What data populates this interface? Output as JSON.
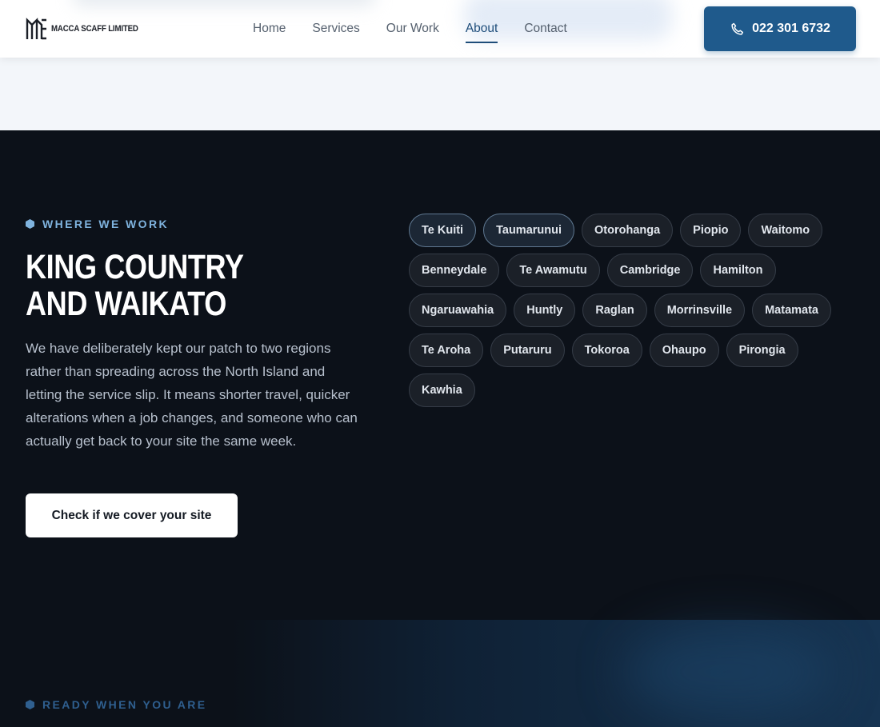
{
  "brand": {
    "name": "MACCA SCAFF LIMITED"
  },
  "nav": {
    "items": [
      {
        "label": "Home",
        "active": false
      },
      {
        "label": "Services",
        "active": false
      },
      {
        "label": "Our Work",
        "active": false
      },
      {
        "label": "About",
        "active": true
      },
      {
        "label": "Contact",
        "active": false
      }
    ],
    "phone_label": "022 301 6732",
    "phone_icon": "phone-icon"
  },
  "coverage": {
    "eyebrow": "WHERE WE WORK",
    "heading_line1": "KING COUNTRY",
    "heading_line2": "AND WAIKATO",
    "body": "We have deliberately kept our patch to two regions rather than spreading across the North Island and letting the service slip. It means shorter travel, quicker alterations when a job changes, and someone who can actually get back to your site the same week.",
    "cta_label": "Check if we cover your site",
    "towns": [
      {
        "label": "Te Kuiti",
        "highlighted": true
      },
      {
        "label": "Taumarunui",
        "highlighted": true
      },
      {
        "label": "Otorohanga",
        "highlighted": false
      },
      {
        "label": "Piopio",
        "highlighted": false
      },
      {
        "label": "Waitomo",
        "highlighted": false
      },
      {
        "label": "Benneydale",
        "highlighted": false
      },
      {
        "label": "Te Awamutu",
        "highlighted": false
      },
      {
        "label": "Cambridge",
        "highlighted": false
      },
      {
        "label": "Hamilton",
        "highlighted": false
      },
      {
        "label": "Ngaruawahia",
        "highlighted": false
      },
      {
        "label": "Huntly",
        "highlighted": false
      },
      {
        "label": "Raglan",
        "highlighted": false
      },
      {
        "label": "Morrinsville",
        "highlighted": false
      },
      {
        "label": "Matamata",
        "highlighted": false
      },
      {
        "label": "Te Aroha",
        "highlighted": false
      },
      {
        "label": "Putaruru",
        "highlighted": false
      },
      {
        "label": "Tokoroa",
        "highlighted": false
      },
      {
        "label": "Ohaupo",
        "highlighted": false
      },
      {
        "label": "Pirongia",
        "highlighted": false
      },
      {
        "label": "Kawhia",
        "highlighted": false
      }
    ]
  },
  "next_section": {
    "eyebrow": "READY WHEN YOU ARE"
  },
  "colors": {
    "primary": "#1f5a8c",
    "dark_bg": "#0c1119",
    "accent_light": "#7fb3de"
  }
}
